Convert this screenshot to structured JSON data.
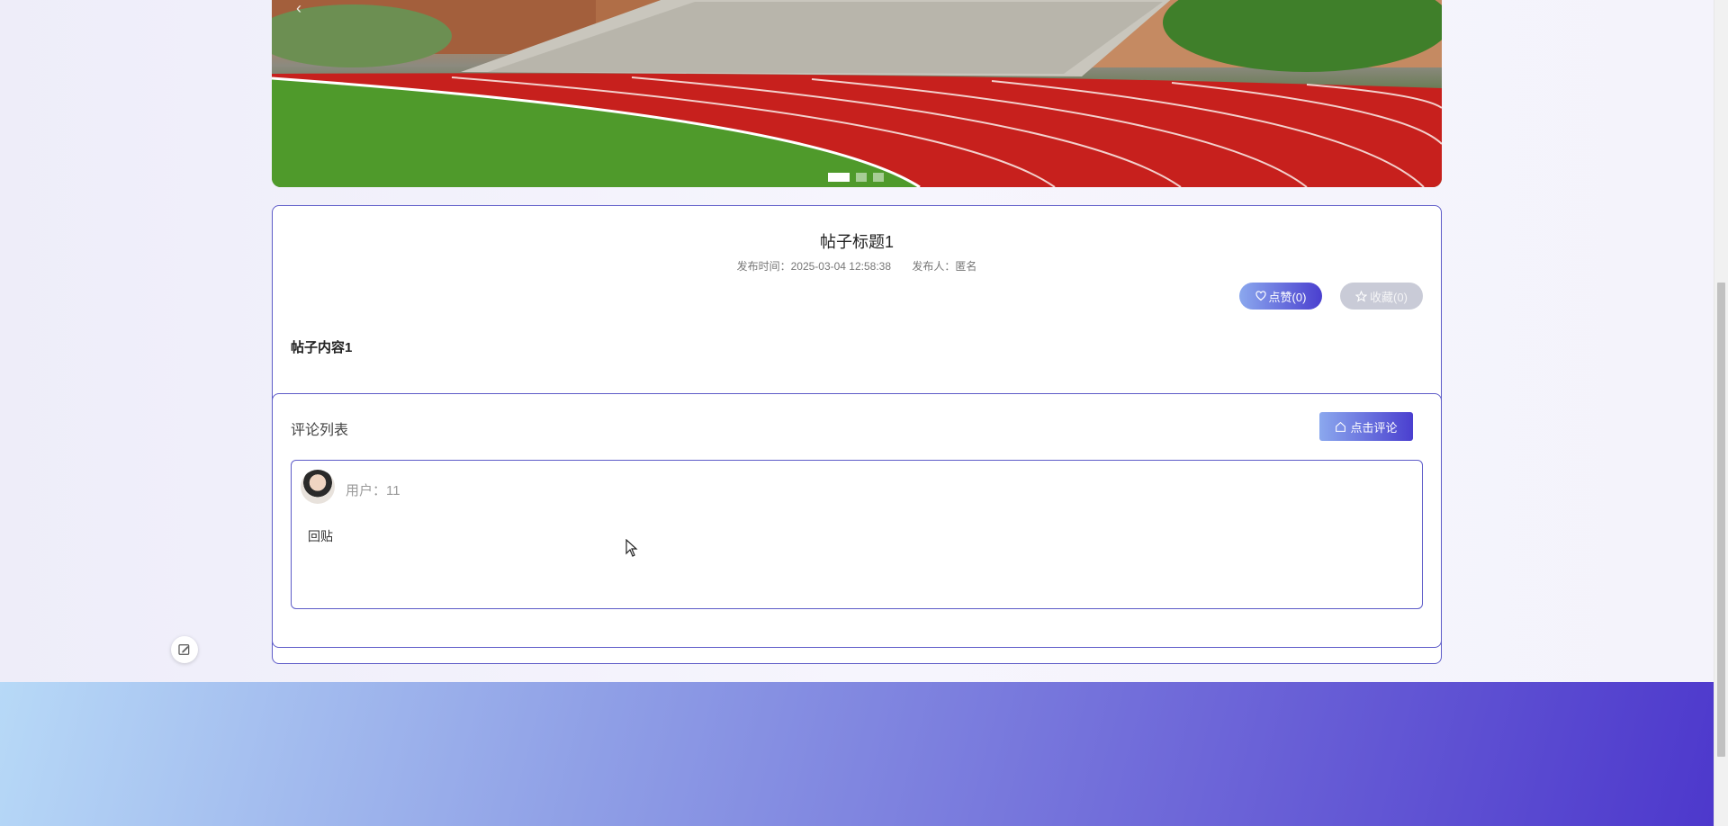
{
  "banner": {
    "prev_icon": "chevron-left-icon",
    "slides": 3,
    "active_slide": 1
  },
  "post": {
    "title": "帖子标题1",
    "publish_time_label": "发布时间：2025-03-04 12:58:38",
    "publisher_label": "发布人：匿名",
    "like_label": "点赞(0)",
    "like_icon": "heart-icon",
    "favorite_label": "收藏(0)",
    "favorite_icon": "star-icon",
    "content": "帖子内容1"
  },
  "comments": {
    "title": "评论列表",
    "add_button_label": "点击评论",
    "add_button_icon": "home-icon",
    "items": [
      {
        "user_label": "用户：11",
        "text": "回贴"
      }
    ]
  },
  "float_button_icon": "edit-icon",
  "colors": {
    "accent": "#5d5bc8",
    "gradient_start": "#8ba8ee",
    "gradient_end": "#4a3fcf",
    "footer_start": "#b7d9f7",
    "footer_end": "#4d38cc"
  }
}
